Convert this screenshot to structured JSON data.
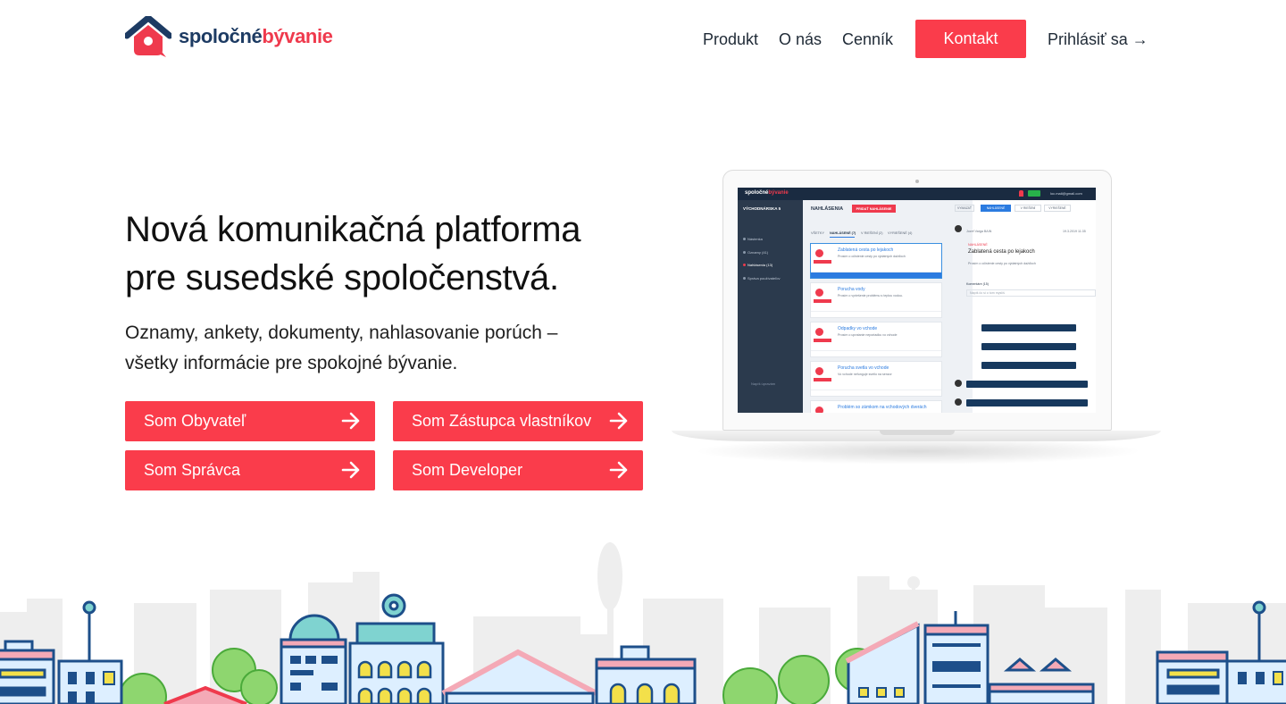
{
  "brand": {
    "name_part1": "spoločné",
    "name_part2": "bývanie",
    "primary_color": "#1d3b63",
    "accent_color": "#ef3a4d"
  },
  "nav": {
    "items": [
      "Produkt",
      "O nás",
      "Cenník"
    ],
    "contact_label": "Kontakt",
    "login_label": "Prihlásiť sa →"
  },
  "hero": {
    "title_line1": "Nová komunikačná platforma",
    "title_line2": "pre susedské spoločenstvá.",
    "subtitle_line1": "Oznamy, ankety, dokumenty, nahlasovanie porúch –",
    "subtitle_line2": "všetky informácie pre spokojné bývanie.",
    "buttons": [
      "Som Obyvateľ",
      "Som Zástupca vlastníkov",
      "Som Správca",
      "Som Developer"
    ],
    "button_color": "#fa3c4b"
  },
  "app_preview": {
    "brand_part1": "spoločné",
    "brand_part2": "bývanie",
    "user_email": "loc.mail@gmail.com",
    "building": "VÝCHODNÁRSKA 5",
    "sidebar": [
      "Nástenka",
      "Oznamy (41)",
      "Nahlásenia (13)",
      "Správa používateľov"
    ],
    "sidebar_footer": "Napíš úpravám",
    "section_title": "NAHLÁSENIA",
    "new_report_label": "PRIDAŤ NAHLÁSENIE",
    "tabs": [
      "VŠETKY",
      "NAHLÁSENÉ (7)",
      "V RIEŠENÍ (2)",
      "VYRIEŠENÉ (4)"
    ],
    "cards": [
      {
        "title": "Zablatená cesta po lejakoch",
        "text": "Prosím o očistenie cesty po výdatných dažďoch"
      },
      {
        "title": "Porucha vody",
        "text": "Prosím o vyriešenie problému s teplou vodou."
      },
      {
        "title": "Odpadky vo vchode",
        "text": "Prosím o upratanie neporiadku vo vchode"
      },
      {
        "title": "Porucha svetla vo vchode",
        "text": "Vo vchode nefunguje svetlo na senzor"
      },
      {
        "title": "Problém so zámkom na vchodových dverách",
        "text": ""
      }
    ],
    "detail_actions": [
      "VYMAZAŤ",
      "NAHLÁSENÉ",
      "V RIEŠENÍ",
      "VYRIEŠENÉ"
    ],
    "detail_author": "Jozef Varga BAIN",
    "detail_date": "19.3.2019 11:35",
    "detail_badge": "NAHLÁSENÉ",
    "detail_title": "Zablatená cesta po lejakoch",
    "detail_text": "Prosím o očistenie cesty po výdatných dažďoch",
    "comments_label": "Komentáre (15)",
    "comment_placeholder": "Napíš čo si o tom myslíš"
  }
}
